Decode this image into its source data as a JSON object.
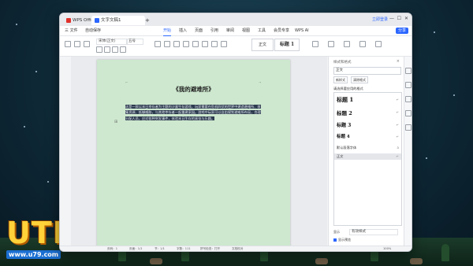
{
  "window": {
    "app_tab": "WPS Office",
    "doc_tab": "文字文稿1",
    "new_tab": "+",
    "login": "立即登录",
    "controls": [
      "—",
      "☐",
      "✕"
    ]
  },
  "menubar": {
    "file": "三 文件",
    "autosave": "自动保存",
    "items": [
      "开始",
      "插入",
      "页面",
      "引用",
      "审阅",
      "视图",
      "工具",
      "会员专享",
      "WPS AI"
    ],
    "active_index": 0,
    "share": "分享"
  },
  "toolbar": {
    "font_name": "宋体(正文)",
    "font_size": "五号",
    "style_normal": "正文",
    "style_heading": "标题 1"
  },
  "document": {
    "title": "《我的避难所》",
    "paragraph": "这是一款以末日幸存者为主题的沙盒生存游戏，玩家需要在危机四伏的世界中建造避难所、收集资源、抵御威胁，与其他幸存者一起重建家园。游戏中玩家可以自由规划避难所布局，合理分配人员，应对各种突发事件，体验末日生存的紧张与乐趣。"
  },
  "style_panel": {
    "title": "样式和格式",
    "current_style": "正文",
    "btn_new": "新样式",
    "btn_clear": "清除格式",
    "list_label": "请选择要应用的格式",
    "styles": [
      {
        "label": "标题 1",
        "size": 7
      },
      {
        "label": "标题 2",
        "size": 6.5
      },
      {
        "label": "标题 3",
        "size": 6
      },
      {
        "label": "标题 4",
        "size": 5.5
      }
    ],
    "default_font": "默认段落字体",
    "normal": "正文",
    "show_label": "显示",
    "show_value": "有效样式",
    "preview_label": "显示预览"
  },
  "statusbar": {
    "page": "页码：1",
    "pages": "页面：1/1",
    "section": "节：1/1",
    "words": "字数：111",
    "spell": "拼写检查：打开",
    "proof": "文档校对",
    "zoom": "100%"
  },
  "watermark": {
    "brand": "UTEG",
    "site": "www.u79.com"
  },
  "colors": {
    "accent": "#2b66ff",
    "page_bg": "#cde8ce",
    "selection": "#2d3b4f"
  }
}
